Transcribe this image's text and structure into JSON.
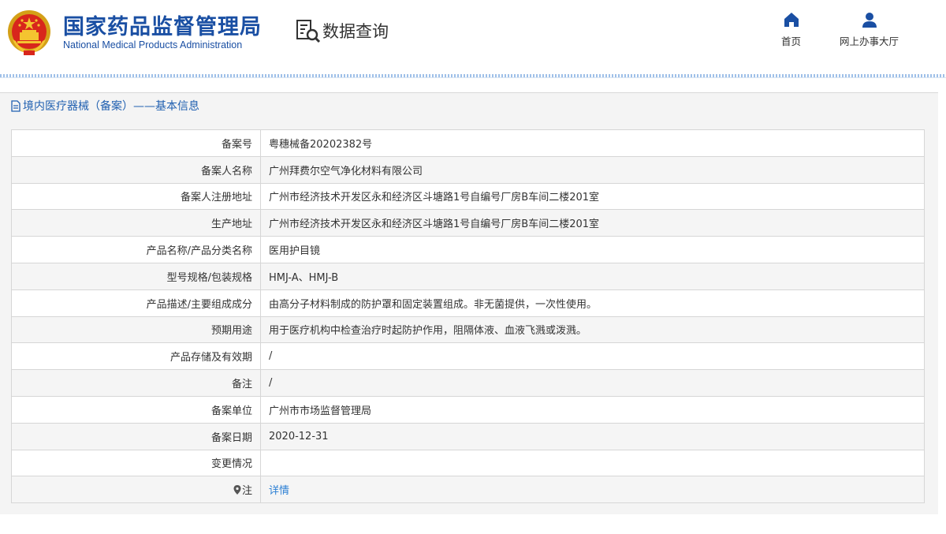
{
  "header": {
    "brand_cn": "国家药品监督管理局",
    "brand_en": "National Medical Products Administration",
    "query_label": "数据查询",
    "nav": {
      "home": "首页",
      "hall": "网上办事大厅"
    }
  },
  "panel": {
    "title": "境内医疗器械（备案）——基本信息"
  },
  "rows": [
    {
      "label": "备案号",
      "value": "粤穗械备20202382号"
    },
    {
      "label": "备案人名称",
      "value": "广州拜费尔空气净化材料有限公司"
    },
    {
      "label": "备案人注册地址",
      "value": "广州市经济技术开发区永和经济区斗塘路1号自编号厂房B车间二楼201室"
    },
    {
      "label": "生产地址",
      "value": "广州市经济技术开发区永和经济区斗塘路1号自编号厂房B车间二楼201室"
    },
    {
      "label": "产品名称/产品分类名称",
      "value": "医用护目镜"
    },
    {
      "label": "型号规格/包装规格",
      "value": "HMJ-A、HMJ-B"
    },
    {
      "label": "产品描述/主要组成成分",
      "value": "由高分子材料制成的防护罩和固定装置组成。非无菌提供，一次性使用。"
    },
    {
      "label": "预期用途",
      "value": "用于医疗机构中检查治疗时起防护作用，阻隔体液、血液飞溅或泼溅。"
    },
    {
      "label": "产品存储及有效期",
      "value": "/"
    },
    {
      "label": "备注",
      "value": "/"
    },
    {
      "label": "备案单位",
      "value": "广州市市场监督管理局"
    },
    {
      "label": "备案日期",
      "value": "2020-12-31"
    },
    {
      "label": "变更情况",
      "value": ""
    },
    {
      "label": "注",
      "value": "详情"
    }
  ],
  "icons": {
    "emblem": "national-emblem-icon",
    "query": "document-search-icon",
    "home": "home-icon",
    "hall": "user-icon",
    "panel": "document-icon",
    "note": "pin-icon"
  },
  "colors": {
    "brand": "#1a4fa3",
    "link": "#2b7fd4",
    "panel_title": "#1f5fb0"
  }
}
